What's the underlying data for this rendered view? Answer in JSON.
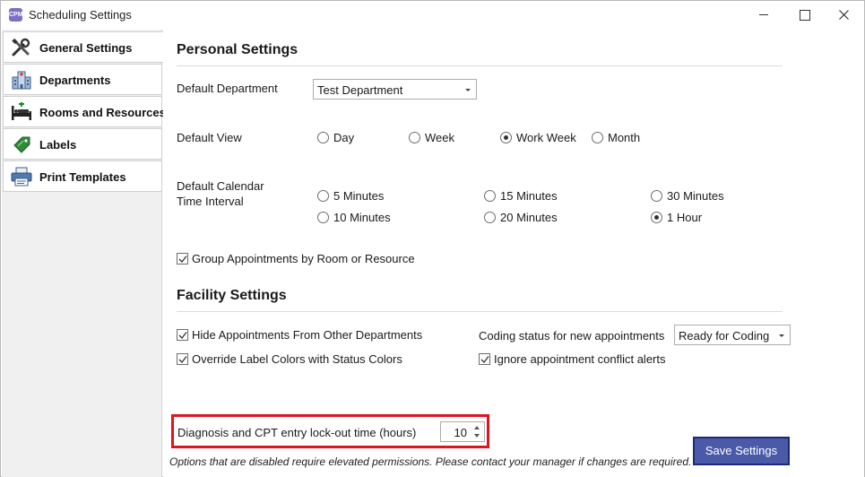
{
  "window": {
    "title": "Scheduling Settings",
    "app_icon_text": "CPM",
    "minimize": "minimize",
    "maximize": "maximize",
    "close": "close"
  },
  "sidebar": {
    "items": [
      {
        "label": "General Settings",
        "icon": "tools-icon",
        "active": true
      },
      {
        "label": "Departments",
        "icon": "building-icon",
        "active": false
      },
      {
        "label": "Rooms and Resources",
        "icon": "bed-icon",
        "active": false
      },
      {
        "label": "Labels",
        "icon": "tag-icon",
        "active": false
      },
      {
        "label": "Print Templates",
        "icon": "printer-icon",
        "active": false
      }
    ]
  },
  "personal": {
    "title": "Personal Settings",
    "default_department_label": "Default Department",
    "default_department_value": "Test Department",
    "default_view_label": "Default View",
    "views": [
      "Day",
      "Week",
      "Work Week",
      "Month"
    ],
    "selected_view": "Work Week",
    "interval_label_line1": "Default Calendar",
    "interval_label_line2": "Time Interval",
    "intervals": [
      "5 Minutes",
      "15 Minutes",
      "30 Minutes",
      "10 Minutes",
      "20 Minutes",
      "1 Hour"
    ],
    "selected_interval": "1 Hour",
    "group_by_room_label": "Group Appointments by Room or Resource",
    "group_by_room_checked": true
  },
  "facility": {
    "title": "Facility Settings",
    "hide_other_depts_label": "Hide Appointments From Other Departments",
    "hide_other_depts_checked": true,
    "override_colors_label": "Override Label Colors with Status Colors",
    "override_colors_checked": true,
    "coding_status_label": "Coding status for new appointments",
    "coding_status_value": "Ready for Coding",
    "ignore_conflicts_label": "Ignore appointment conflict alerts",
    "ignore_conflicts_checked": true
  },
  "lockout": {
    "label": "Diagnosis and CPT entry lock-out time (hours)",
    "value": "10"
  },
  "footer": {
    "save_label": "Save Settings",
    "note": "Options that are disabled require elevated permissions.  Please contact your manager if changes are required."
  },
  "colors": {
    "highlight_border": "#e0141e",
    "save_button": "#4a5aa8",
    "sidebar_bg": "#f0f0f0"
  }
}
